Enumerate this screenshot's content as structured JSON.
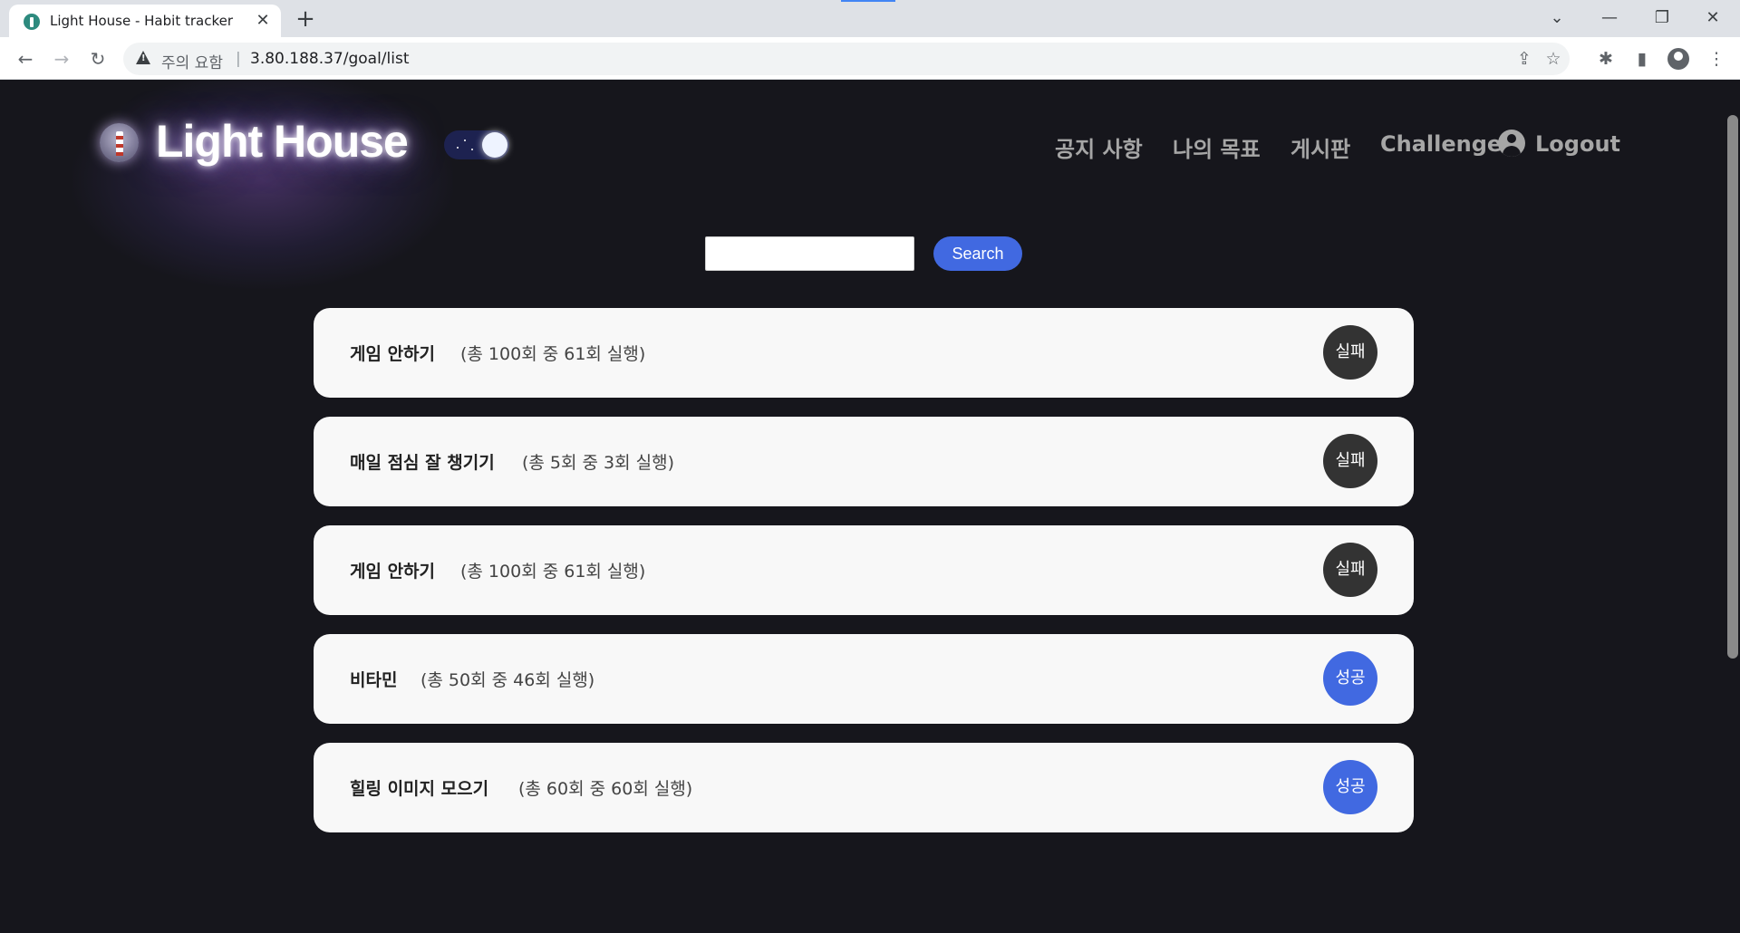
{
  "browser": {
    "tab_title": "Light House - Habit tracker",
    "close_glyph": "✕",
    "new_tab_glyph": "+",
    "security_label": "주의 요함",
    "separator": "|",
    "url": "3.80.188.37/goal/list",
    "window_controls": [
      "⌄",
      "—",
      "❐",
      "✕"
    ],
    "nav_glyphs": {
      "back": "←",
      "forward": "→",
      "reload": "↻"
    },
    "toolbar_glyphs": {
      "share": "⇪",
      "bookmark": "☆",
      "extensions": "✱",
      "side_panel": "▮",
      "menu": "⋮"
    }
  },
  "header": {
    "brand": "Light House",
    "nav": [
      {
        "label": "공지 사항"
      },
      {
        "label": "나의 목표"
      },
      {
        "label": "게시판"
      },
      {
        "label": "Challenge"
      },
      {
        "label": "Logout"
      }
    ]
  },
  "search": {
    "value": "",
    "button_label": "Search"
  },
  "goals": [
    {
      "title": "게임 안하기",
      "progress": "(총 100회 중 61회 실행)",
      "status": "실패",
      "status_type": "fail"
    },
    {
      "title": "매일 점심 잘 챙기기",
      "progress": "(총 5회 중 3회 실행)",
      "status": "실패",
      "status_type": "fail"
    },
    {
      "title": "게임 안하기",
      "progress": "(총 100회 중 61회 실행)",
      "status": "실패",
      "status_type": "fail"
    },
    {
      "title": "비타민",
      "progress": "(총 50회 중 46회 실행)",
      "status": "성공",
      "status_type": "success"
    },
    {
      "title": "힐링 이미지 모으기",
      "progress": "(총 60회 중 60회 실행)",
      "status": "성공",
      "status_type": "success"
    }
  ],
  "colors": {
    "page_bg": "#16161c",
    "accent": "#4169e1",
    "fail": "#333333",
    "card_bg": "#f8f8f8"
  }
}
